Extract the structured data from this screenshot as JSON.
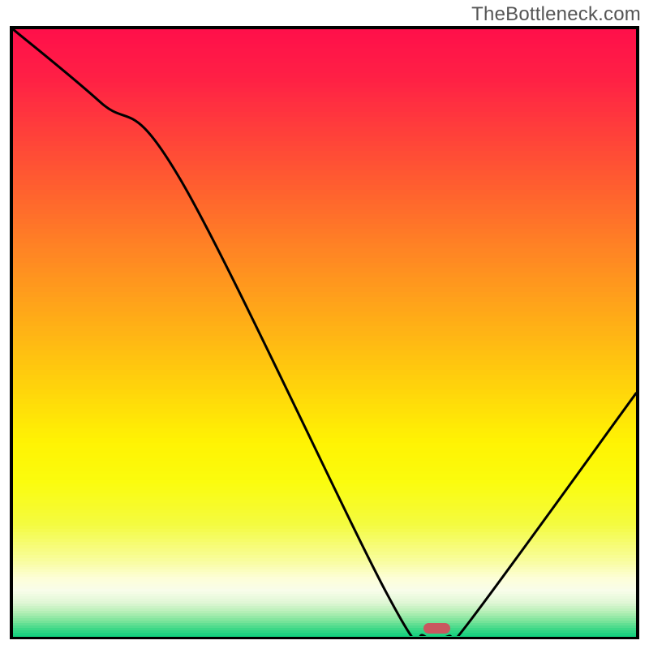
{
  "watermark": "TheBottleneck.com",
  "chart_data": {
    "type": "line",
    "title": "",
    "xlabel": "",
    "ylabel": "",
    "xlim": [
      0,
      100
    ],
    "ylim": [
      0,
      100
    ],
    "x": [
      0,
      14,
      27,
      60,
      66,
      70,
      73,
      100
    ],
    "values": [
      100,
      88,
      75,
      7,
      0,
      0,
      2,
      40
    ],
    "marker": {
      "x": 68,
      "y": 1.2,
      "color": "#c9575f"
    },
    "gradient_stops": [
      {
        "pos": 0.0,
        "color": "#ff0f4a"
      },
      {
        "pos": 0.08,
        "color": "#ff2045"
      },
      {
        "pos": 0.18,
        "color": "#ff4339"
      },
      {
        "pos": 0.28,
        "color": "#ff662d"
      },
      {
        "pos": 0.38,
        "color": "#ff8a22"
      },
      {
        "pos": 0.48,
        "color": "#ffad17"
      },
      {
        "pos": 0.58,
        "color": "#ffd00c"
      },
      {
        "pos": 0.68,
        "color": "#fff303"
      },
      {
        "pos": 0.745,
        "color": "#fbfc0d"
      },
      {
        "pos": 0.815,
        "color": "#f4fb3f"
      },
      {
        "pos": 0.875,
        "color": "#f8fd9c"
      },
      {
        "pos": 0.905,
        "color": "#fdfed8"
      },
      {
        "pos": 0.925,
        "color": "#f8fdea"
      },
      {
        "pos": 0.945,
        "color": "#e0f7d5"
      },
      {
        "pos": 0.96,
        "color": "#b6efb7"
      },
      {
        "pos": 0.975,
        "color": "#7de49b"
      },
      {
        "pos": 0.988,
        "color": "#3fd888"
      },
      {
        "pos": 1.0,
        "color": "#12d07e"
      }
    ]
  },
  "ui": {
    "plot_inner_w": 768,
    "plot_inner_h": 748
  }
}
